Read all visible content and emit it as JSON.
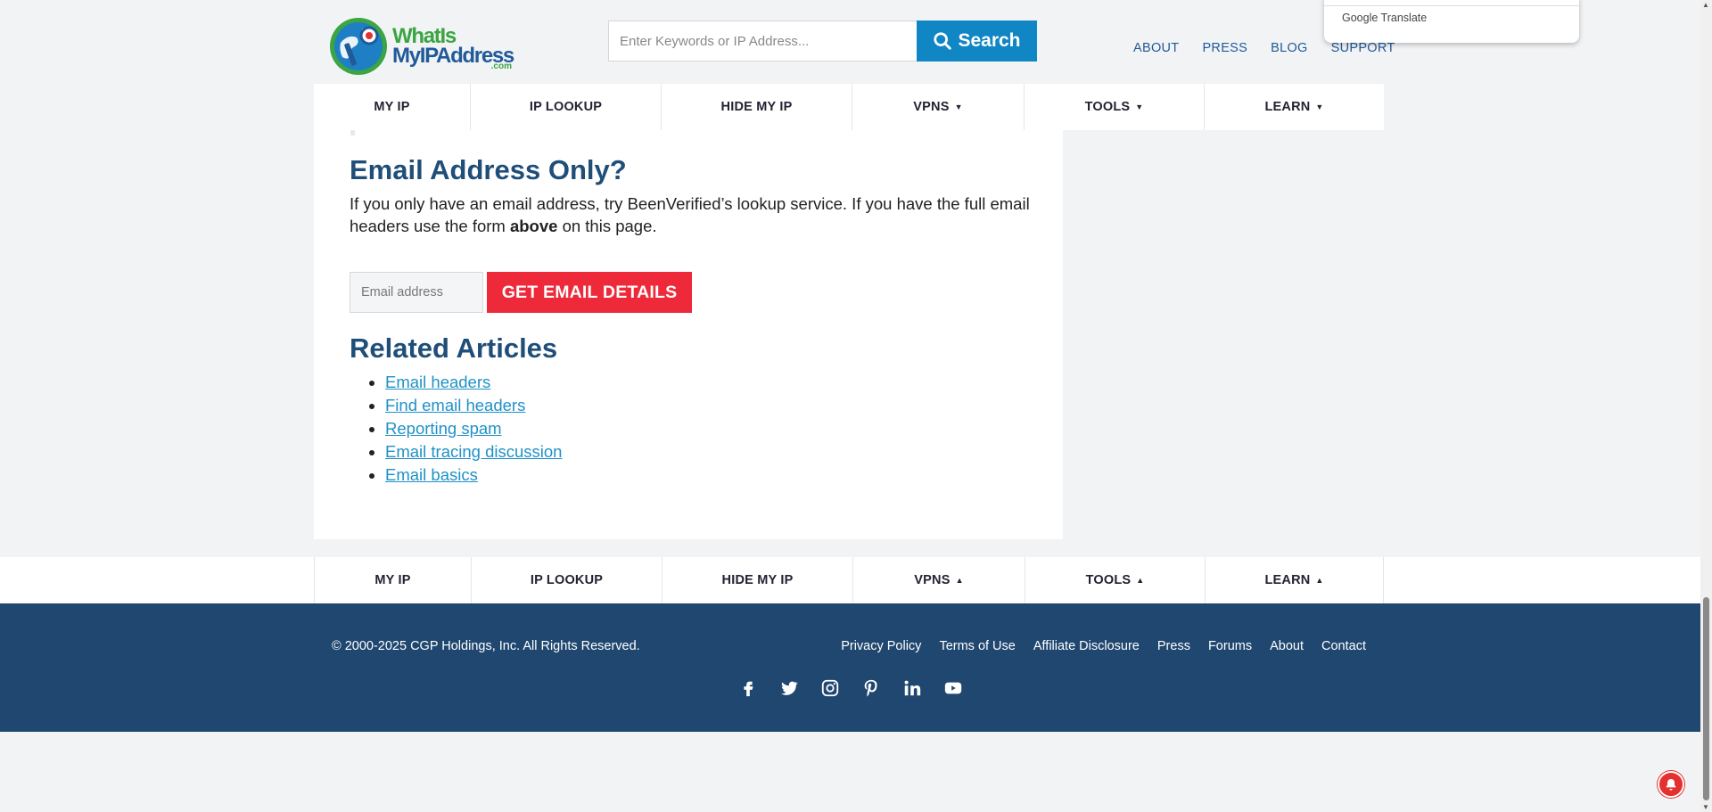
{
  "header": {
    "logo": {
      "line1": "WhatIs",
      "line2": "MyIPAddress",
      "dotcom": ".com"
    },
    "search": {
      "placeholder": "Enter Keywords or IP Address...",
      "value": "",
      "button_label": "Search"
    },
    "top_links": [
      "ABOUT",
      "PRESS",
      "BLOG",
      "SUPPORT"
    ],
    "google_translate": "Google Translate"
  },
  "nav_top": [
    {
      "label": "MY IP",
      "caret": ""
    },
    {
      "label": "IP LOOKUP",
      "caret": ""
    },
    {
      "label": "HIDE MY IP",
      "caret": ""
    },
    {
      "label": "VPNS",
      "caret": "▼"
    },
    {
      "label": "TOOLS",
      "caret": "▼"
    },
    {
      "label": "LEARN",
      "caret": "▼"
    }
  ],
  "nav_bottom": [
    {
      "label": "MY IP",
      "caret": ""
    },
    {
      "label": "IP LOOKUP",
      "caret": ""
    },
    {
      "label": "HIDE MY IP",
      "caret": ""
    },
    {
      "label": "VPNS",
      "caret": "▲"
    },
    {
      "label": "TOOLS",
      "caret": "▲"
    },
    {
      "label": "LEARN",
      "caret": "▲"
    }
  ],
  "main": {
    "email_heading": "Email Address Only?",
    "email_text_1": "If you only have an email address, try BeenVerified’s lookup service. If you have the full email headers use the form ",
    "email_text_bold": "above",
    "email_text_2": " on this page.",
    "email_input_placeholder": "Email address",
    "email_button": "GET EMAIL DETAILS",
    "related_heading": "Related Articles",
    "related_links": [
      "Email headers",
      "Find email headers",
      "Reporting spam",
      "Email tracing discussion",
      "Email basics"
    ]
  },
  "footer": {
    "copyright": "© 2000-2025 CGP Holdings, Inc. All Rights Reserved.",
    "links": [
      "Privacy Policy",
      "Terms of Use",
      "Affiliate Disclosure",
      "Press",
      "Forums",
      "About",
      "Contact"
    ],
    "social": [
      "facebook-icon",
      "twitter-icon",
      "instagram-icon",
      "pinterest-icon",
      "linkedin-icon",
      "youtube-icon"
    ]
  },
  "colors": {
    "brand_blue": "#1f4e79",
    "search_button": "#1186c4",
    "cta_red": "#ee2939",
    "footer_bg": "#1f4770",
    "link": "#1f91c7"
  }
}
